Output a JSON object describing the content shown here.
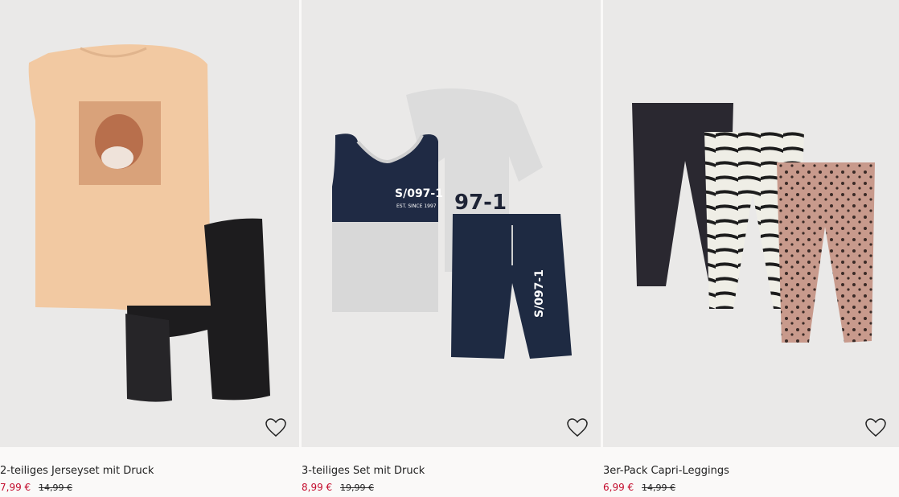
{
  "products": [
    {
      "title": "2-teiliges Jerseyset mit Druck",
      "sale_price": "7,99 €",
      "old_price": "14,99 €",
      "favorite_icon": "heart-outline-icon",
      "print_text": ""
    },
    {
      "title": "3-teiliges Set mit Druck",
      "sale_price": "8,99 €",
      "old_price": "19,99 €",
      "favorite_icon": "heart-outline-icon",
      "print_text": "S/097-1",
      "print_sub": "EST. SINCE 1997"
    },
    {
      "title": "3er-Pack Capri-Leggings",
      "sale_price": "6,99 €",
      "old_price": "14,99 €",
      "favorite_icon": "heart-outline-icon"
    }
  ],
  "colors": {
    "sale": "#c30b2c",
    "background": "#faf9f8",
    "photo_bg": "#eae9e8"
  }
}
